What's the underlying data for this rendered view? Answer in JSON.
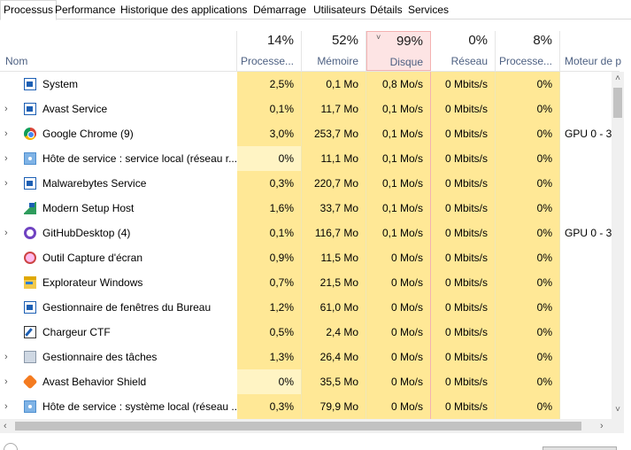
{
  "tabs": [
    "Processus",
    "Performance",
    "Historique des applications",
    "Démarrage",
    "Utilisateurs",
    "Détails",
    "Services"
  ],
  "header": {
    "name_label": "Nom",
    "columns": [
      {
        "pct": "14%",
        "label": "Processe..."
      },
      {
        "pct": "52%",
        "label": "Mémoire"
      },
      {
        "pct": "99%",
        "label": "Disque"
      },
      {
        "pct": "0%",
        "label": "Réseau"
      },
      {
        "pct": "8%",
        "label": "Processe..."
      },
      {
        "pct": "",
        "label": "Moteur de p"
      }
    ],
    "sort_indicator": "˅"
  },
  "rows": [
    {
      "expander": "",
      "icon": "window-icon",
      "name": "System",
      "cpu": "2,5%",
      "mem": "0,1 Mo",
      "disk": "0,8 Mo/s",
      "net": "0 Mbits/s",
      "gpu": "0%",
      "gpu_engine": ""
    },
    {
      "expander": "›",
      "icon": "window-icon",
      "name": "Avast Service",
      "cpu": "0,1%",
      "mem": "11,7 Mo",
      "disk": "0,1 Mo/s",
      "net": "0 Mbits/s",
      "gpu": "0%",
      "gpu_engine": ""
    },
    {
      "expander": "›",
      "icon": "chrome-icon",
      "name": "Google Chrome (9)",
      "cpu": "3,0%",
      "mem": "253,7 Mo",
      "disk": "0,1 Mo/s",
      "net": "0 Mbits/s",
      "gpu": "0%",
      "gpu_engine": "GPU 0 - 3"
    },
    {
      "expander": "›",
      "icon": "service-host-icon",
      "name": "Hôte de service : service local (réseau r...",
      "cpu": "0%",
      "mem": "11,1 Mo",
      "disk": "0,1 Mo/s",
      "net": "0 Mbits/s",
      "gpu": "0%",
      "gpu_engine": ""
    },
    {
      "expander": "›",
      "icon": "window-icon",
      "name": "Malwarebytes Service",
      "cpu": "0,3%",
      "mem": "220,7 Mo",
      "disk": "0,1 Mo/s",
      "net": "0 Mbits/s",
      "gpu": "0%",
      "gpu_engine": ""
    },
    {
      "expander": "",
      "icon": "modern-setup-icon",
      "name": "Modern Setup Host",
      "cpu": "1,6%",
      "mem": "33,7 Mo",
      "disk": "0,1 Mo/s",
      "net": "0 Mbits/s",
      "gpu": "0%",
      "gpu_engine": ""
    },
    {
      "expander": "›",
      "icon": "github-icon",
      "name": "GitHubDesktop (4)",
      "cpu": "0,1%",
      "mem": "116,7 Mo",
      "disk": "0,1 Mo/s",
      "net": "0 Mbits/s",
      "gpu": "0%",
      "gpu_engine": "GPU 0 - 3"
    },
    {
      "expander": "",
      "icon": "snipping-tool-icon",
      "name": "Outil Capture d'écran",
      "cpu": "0,9%",
      "mem": "11,5 Mo",
      "disk": "0 Mo/s",
      "net": "0 Mbits/s",
      "gpu": "0%",
      "gpu_engine": ""
    },
    {
      "expander": "",
      "icon": "folder-icon",
      "name": "Explorateur Windows",
      "cpu": "0,7%",
      "mem": "21,5 Mo",
      "disk": "0 Mo/s",
      "net": "0 Mbits/s",
      "gpu": "0%",
      "gpu_engine": ""
    },
    {
      "expander": "",
      "icon": "window-icon",
      "name": "Gestionnaire de fenêtres du Bureau",
      "cpu": "1,2%",
      "mem": "61,0 Mo",
      "disk": "0 Mo/s",
      "net": "0 Mbits/s",
      "gpu": "0%",
      "gpu_engine": ""
    },
    {
      "expander": "",
      "icon": "ctf-loader-icon",
      "name": "Chargeur CTF",
      "cpu": "0,5%",
      "mem": "2,4 Mo",
      "disk": "0 Mo/s",
      "net": "0 Mbits/s",
      "gpu": "0%",
      "gpu_engine": ""
    },
    {
      "expander": "›",
      "icon": "task-manager-icon",
      "name": "Gestionnaire des tâches",
      "cpu": "1,3%",
      "mem": "26,4 Mo",
      "disk": "0 Mo/s",
      "net": "0 Mbits/s",
      "gpu": "0%",
      "gpu_engine": ""
    },
    {
      "expander": "›",
      "icon": "avast-icon",
      "name": "Avast Behavior Shield",
      "cpu": "0%",
      "mem": "35,5 Mo",
      "disk": "0 Mo/s",
      "net": "0 Mbits/s",
      "gpu": "0%",
      "gpu_engine": ""
    },
    {
      "expander": "›",
      "icon": "service-host-icon",
      "name": "Hôte de service : système local (réseau ...",
      "cpu": "0,3%",
      "mem": "79,9 Mo",
      "disk": "0 Mo/s",
      "net": "0 Mbits/s",
      "gpu": "0%",
      "gpu_engine": ""
    }
  ],
  "scrollbar": {
    "up": "˄",
    "down": "˅",
    "left": "‹",
    "right": "›"
  },
  "colors": {
    "heat_light": "#fff4c4",
    "heat_medium": "#ffe896",
    "sorted_header": "#fde4e4",
    "header_label": "#4d6082"
  }
}
